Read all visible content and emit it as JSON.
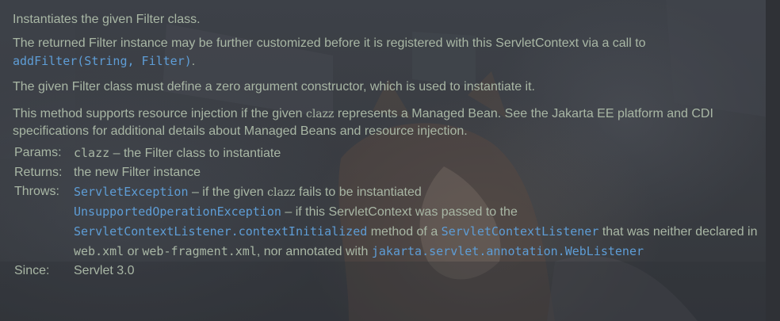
{
  "doc": {
    "summary": "Instantiates the given Filter class.",
    "para2": {
      "text": "The returned Filter instance may be further customized before it is registered with this ServletContext via a call to",
      "link": "addFilter(String, Filter)",
      "end": "."
    },
    "para3": "The given Filter class must define a zero argument constructor, which is used to instantiate it.",
    "para4": {
      "before": "This method supports resource injection if the given",
      "code": "clazz",
      "after": "represents a Managed Bean. See the Jakarta EE platform and CDI specifications for additional details about Managed Beans and resource injection."
    }
  },
  "params": {
    "label": "Params:",
    "name": "clazz",
    "desc": "– the Filter class to instantiate"
  },
  "returns": {
    "label": "Returns:",
    "desc": "the new Filter instance"
  },
  "throws": {
    "label": "Throws:",
    "line1": {
      "exception": "ServletException",
      "before": "– if the given",
      "code": "clazz",
      "after": "fails to be instantiated"
    },
    "line2": {
      "exception": "UnsupportedOperationException",
      "before": "– if this ServletContext was passed to the",
      "method_link": "ServletContextListener.contextInitialized",
      "mid1": "method of a",
      "class_link": "ServletContextListener",
      "mid2": "that was neither declared in",
      "file1": "web.xml",
      "or": "or",
      "file2": "web-fragment.xml",
      "mid3": ", nor annotated with",
      "annotation_link": "jakarta.servlet.annotation.WebListener"
    }
  },
  "since": {
    "label": "Since:",
    "value": "Servlet 3.0"
  }
}
